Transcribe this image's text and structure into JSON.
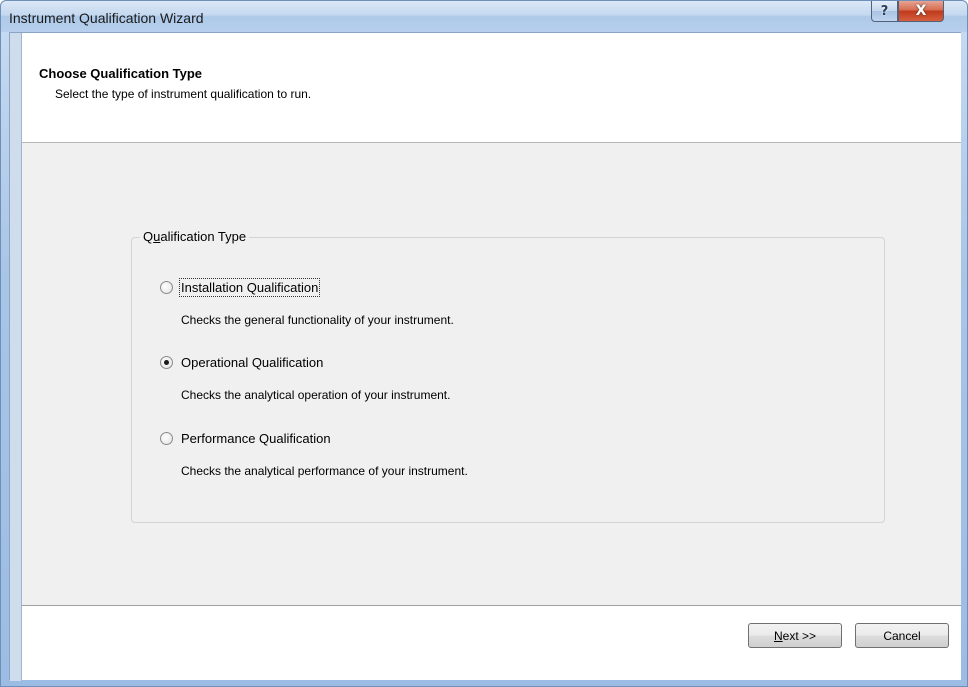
{
  "window": {
    "title": "Instrument Qualification Wizard",
    "help_glyph": "?",
    "close_glyph": "X"
  },
  "header": {
    "title": "Choose Qualification Type",
    "subtitle": "Select the type of instrument qualification to run."
  },
  "group": {
    "legend_prefix": "Q",
    "legend_mnemonic": "u",
    "legend_rest": "alification Type",
    "options": [
      {
        "label": "Installation Qualification",
        "description": "Checks the general functionality of your instrument.",
        "checked": false
      },
      {
        "label": "Operational Qualification",
        "description": "Checks the analytical operation of your instrument.",
        "checked": true
      },
      {
        "label": "Performance Qualification",
        "description": "Checks the analytical performance of your instrument.",
        "checked": false
      }
    ]
  },
  "footer": {
    "next_mnemonic": "N",
    "next_rest": "ext >>",
    "cancel_label": "Cancel"
  },
  "colors": {
    "close_red": "#c0391c",
    "frame_blue": "#a9c5e6"
  }
}
